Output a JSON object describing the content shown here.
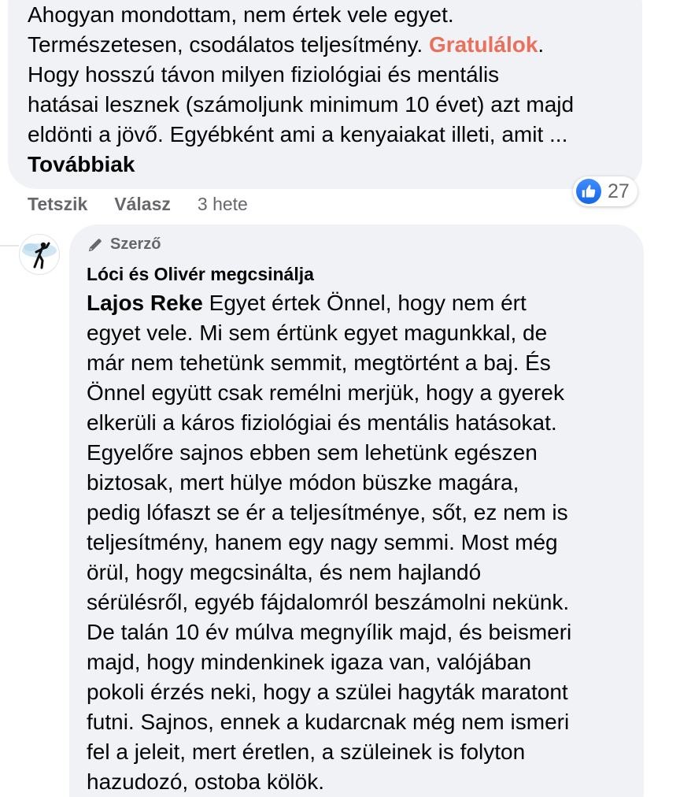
{
  "comment_top": {
    "lines": [
      "Ahogyan mondottam, nem értek vele egyet.",
      "Természetesen, csodálatos teljesítmény.",
      "Hogy hosszú távon milyen fiziológiai és mentális",
      "hatásai lesznek (számoljunk minimum 10 évet) azt majd",
      "eldönti a jövő. Egyébként ami a kenyaiakat illeti, amit ..."
    ],
    "mention": "Gratulálok",
    "mention_suffix": ".",
    "see_more": "Továbbiak",
    "reaction_count": "27",
    "actions": {
      "like": "Tetszik",
      "reply": "Válasz",
      "time": "3 hete"
    }
  },
  "reply": {
    "badge": "Szerző",
    "author": "Lóci és Olivér megcsinálja",
    "tagged_name": "Lajos Reke",
    "first_line_rest": " Egyet értek Önnel, hogy nem ért",
    "lines": [
      "egyet vele. Mi sem értünk egyet magunkkal, de",
      "már nem tehetünk semmit, megtörtént a baj. És",
      "Önnel együtt csak remélni merjük, hogy a gyerek",
      "elkerüli a káros fiziológiai és mentális hatásokat.",
      "Egyelőre sajnos ebben sem lehetünk egészen",
      "biztosak, mert hülye módon büszke magára,",
      "pedig lófaszt se ér a teljesítménye, sőt, ez nem is",
      "teljesítmény, hanem egy nagy semmi. Most még",
      "örül, hogy megcsinálta, és nem hajlandó",
      "sérülésről, egyéb fájdalomról beszámolni nekünk.",
      "De talán 10 év múlva megnyílik majd, és beismeri",
      "majd, hogy mindenkinek igaza van, valójában",
      "pokoli érzés neki, hogy a szülei hagyták maratont",
      "futni. Sajnos, ennek a kudarcnak még nem ismeri",
      "fel a jeleit, mert éretlen, a szüleinek is folyton",
      "hazudozó, ostoba kölök."
    ]
  },
  "colors": {
    "bubble_bg": "#f0f2f5",
    "mention": "#e9705d",
    "secondary_text": "#65676b",
    "like_blue": "#1877f2"
  },
  "icons": {
    "reaction": "like-thumb-icon",
    "badge": "pen-icon",
    "avatar": "runner-silhouette-avatar"
  }
}
